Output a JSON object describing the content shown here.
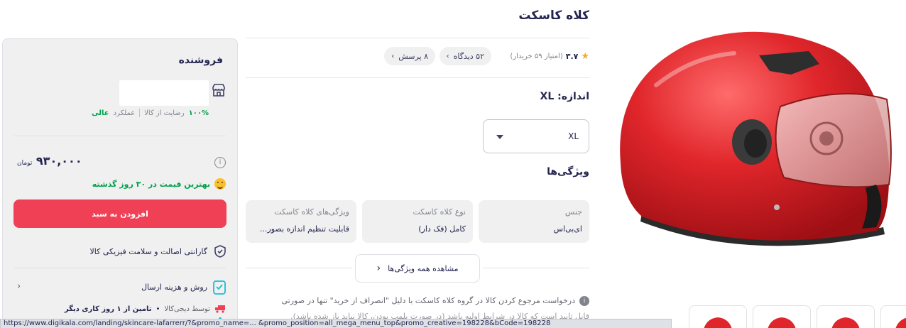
{
  "product": {
    "title": "کلاه کاسکت",
    "rating": {
      "value": "۳.۷",
      "count_text": "(امتیاز ۵۹ خریدار)"
    },
    "pills": {
      "reviews": "۵۲ دیدگاه",
      "questions": "۸ پرسش"
    },
    "size": {
      "label": "اندازه: XL",
      "selected": "XL"
    },
    "features_title": "ویژگی‌ها",
    "features": [
      {
        "key": "جنس",
        "value": "ای‌بی‌اس"
      },
      {
        "key": "نوع کلاه کاسکت",
        "value": "کامل (فک دار)"
      },
      {
        "key": "ویژگی‌های کلاه کاسکت",
        "value": "قابلیت تنظیم اندازه بصور..."
      }
    ],
    "all_features_label": "مشاهده همه ویژگی‌ها",
    "notice": {
      "line1": "درخواست مرجوع کردن کالا در گروه کلاه کاسکت با دلیل \"انصراف از خرید\" تنها در صورتی",
      "line2": "قابل تایید است که کالا در شرایط اولیه باشد (در صورت پلمب بودن، کالا نباید باز شده باشد)."
    }
  },
  "seller": {
    "title": "فروشنده",
    "satisfaction": "۱۰۰%",
    "satisfaction_label": "رضایت از کالا",
    "performance_label": "عملکرد",
    "performance_value": "عالی"
  },
  "buy": {
    "price": "۹۳۰,۰۰۰",
    "currency": "تومان",
    "best_price": "بهترین قیمت در ۳۰ روز گذشته",
    "add_to_cart": "افزودن به سبد",
    "guarantee": "گارانتی اصالت و سلامت فیزیکی کالا",
    "shipping_label": "روش و هزینه ارسال",
    "delivery_sender": "توسط دیجی‌کالا",
    "delivery_time": "تامین از ۱ روز کاری دیگر"
  },
  "statusbar": {
    "url": "https://www.digikala.com/landing/skincare-lafarrerr/?&promo_name=... &promo_position=all_mega_menu_top&promo_creative=198228&bCode=198228"
  },
  "colors": {
    "accent": "#ef4056",
    "success": "#00a049",
    "helmet": "#e0262b"
  }
}
